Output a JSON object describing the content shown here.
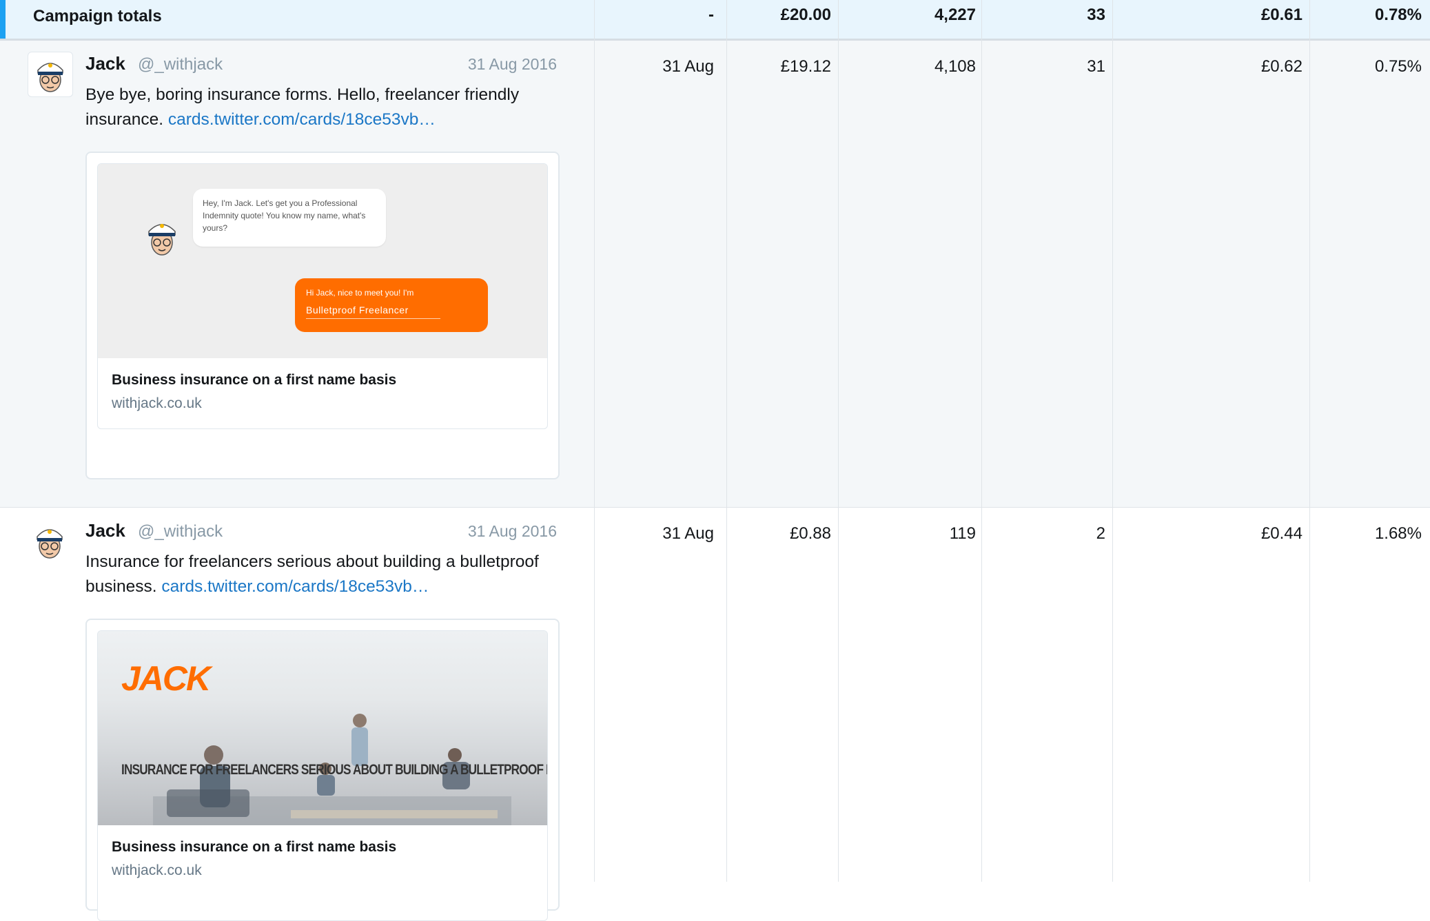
{
  "totals": {
    "label": "Campaign totals",
    "date": "-",
    "spend": "£20.00",
    "impressions": "4,227",
    "clicks": "33",
    "cost_per": "£0.61",
    "rate": "0.78%"
  },
  "rows": [
    {
      "name": "Jack",
      "handle": "@_withjack",
      "date": "31 Aug 2016",
      "text": "Bye bye, boring insurance forms. Hello, freelancer friendly insurance.",
      "link": "cards.twitter.com/cards/18ce53vb…",
      "card": {
        "bubble_white": "Hey, I'm Jack. Let's get you a Professional Indemnity quote! You know my name, what's yours?",
        "bubble_orange_prompt": "Hi Jack, nice to meet you! I'm",
        "bubble_orange_input": "Bulletproof Freelancer",
        "title": "Business insurance on a first name basis",
        "domain": "withjack.co.uk"
      },
      "col_date": "31 Aug",
      "spend": "£19.12",
      "impressions": "4,108",
      "clicks": "31",
      "cost_per": "£0.62",
      "rate": "0.75%"
    },
    {
      "name": "Jack",
      "handle": "@_withjack",
      "date": "31 Aug 2016",
      "text": "Insurance for freelancers serious about building a bulletproof business.",
      "link": "cards.twitter.com/cards/18ce53vb…",
      "card": {
        "logo": "JACK",
        "banner": "INSURANCE FOR FREELANCERS SERIOUS ABOUT BUILDING A BULLETPROOF BUSINESS",
        "title": "Business insurance on a first name basis",
        "domain": "withjack.co.uk"
      },
      "col_date": "31 Aug",
      "spend": "£0.88",
      "impressions": "119",
      "clicks": "2",
      "cost_per": "£0.44",
      "rate": "1.68%"
    }
  ],
  "colors": {
    "accent": "#1da1f2",
    "link": "#1b77c6",
    "orange": "#ff6d00"
  }
}
